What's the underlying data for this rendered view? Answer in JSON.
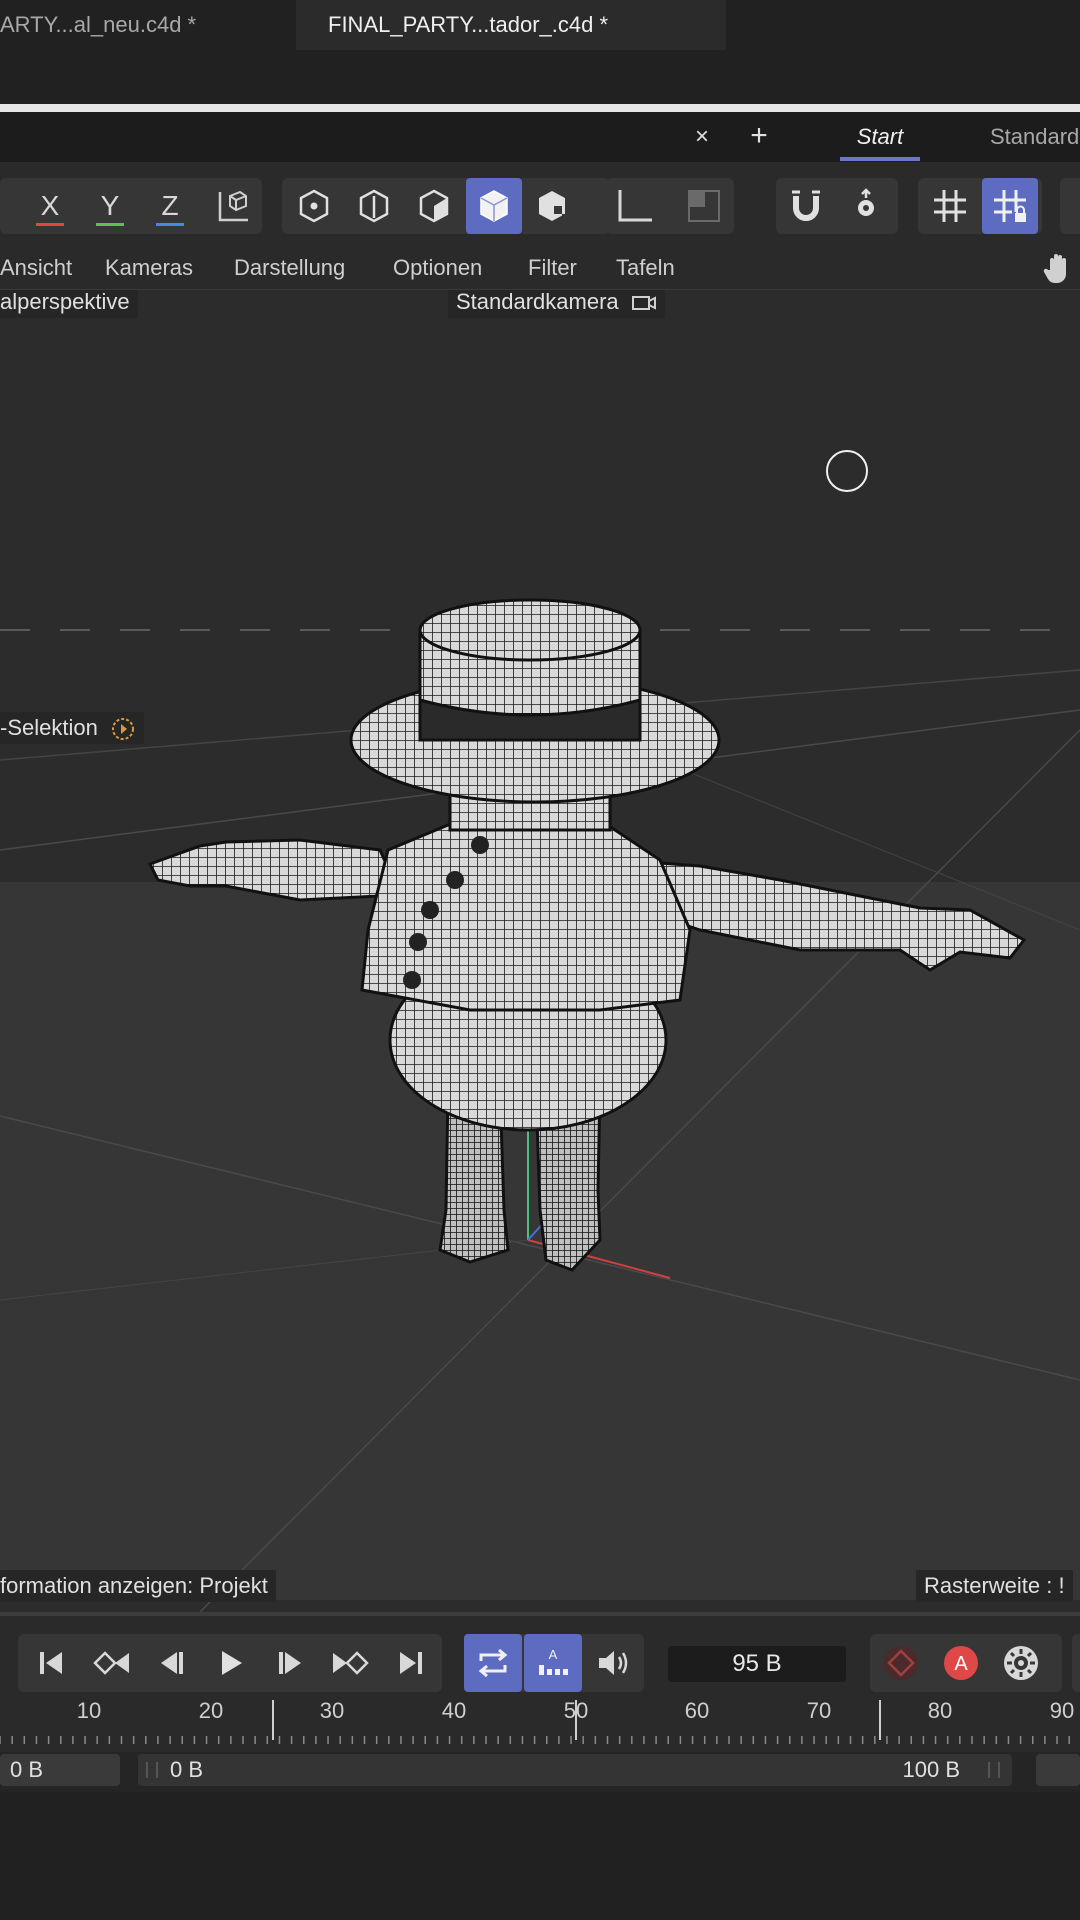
{
  "tabs": [
    {
      "label": "ARTY...al_neu.c4d *",
      "active": false
    },
    {
      "label": "FINAL_PARTY...tador_.c4d *",
      "active": true
    }
  ],
  "tab_close": "×",
  "tab_add": "+",
  "layouts": {
    "start": "Start",
    "standard": "Standard"
  },
  "axis_buttons": [
    {
      "label": "X",
      "color": "#e04848"
    },
    {
      "label": "Y",
      "color": "#5cc24e"
    },
    {
      "label": "Z",
      "color": "#4a86e0"
    }
  ],
  "view_menu": [
    "Ansicht",
    "Kameras",
    "Darstellung",
    "Optionen",
    "Filter",
    "Tafeln"
  ],
  "viewport": {
    "projection_label": "alperspektive",
    "camera_label": "Standardkamera",
    "selection_label": "-Selektion",
    "info_label": "formation anzeigen: Projekt",
    "grid_label": "Rasterweite : !"
  },
  "timeline": {
    "current_frame": "95 B",
    "ruler_ticks": [
      "10",
      "20",
      "30",
      "40",
      "50",
      "60",
      "70",
      "80",
      "90"
    ],
    "range_start": "0 B",
    "range_min": "0 B",
    "range_max": "100 B"
  },
  "colors": {
    "accent": "#5d6cc0",
    "record": "#e04848"
  },
  "icons": [
    "hand-icon",
    "camera-icon",
    "play-icon",
    "loop-icon",
    "sound-icon",
    "settings-icon",
    "magnet-icon",
    "grid-icon"
  ]
}
